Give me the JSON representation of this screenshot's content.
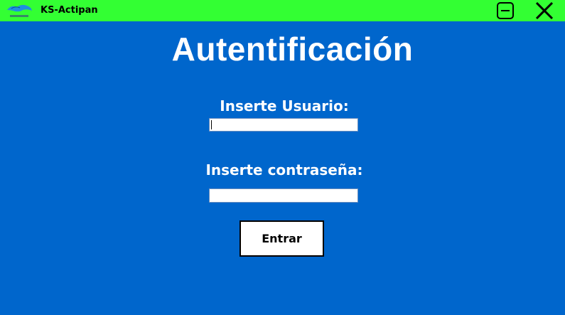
{
  "window": {
    "title": "KS-Actipan",
    "logo_icon": "ks-actipan-logo-icon",
    "controls": {
      "minimize_icon": "minimize-icon",
      "close_icon": "close-icon"
    }
  },
  "colors": {
    "titlebar": "#33ff33",
    "background": "#0066cc",
    "text": "#ffffff"
  },
  "login": {
    "heading": "Autentificación",
    "user_label": "Inserte Usuario:",
    "user_value": "",
    "password_label": "Inserte contraseña:",
    "password_value": "",
    "submit_label": "Entrar"
  }
}
